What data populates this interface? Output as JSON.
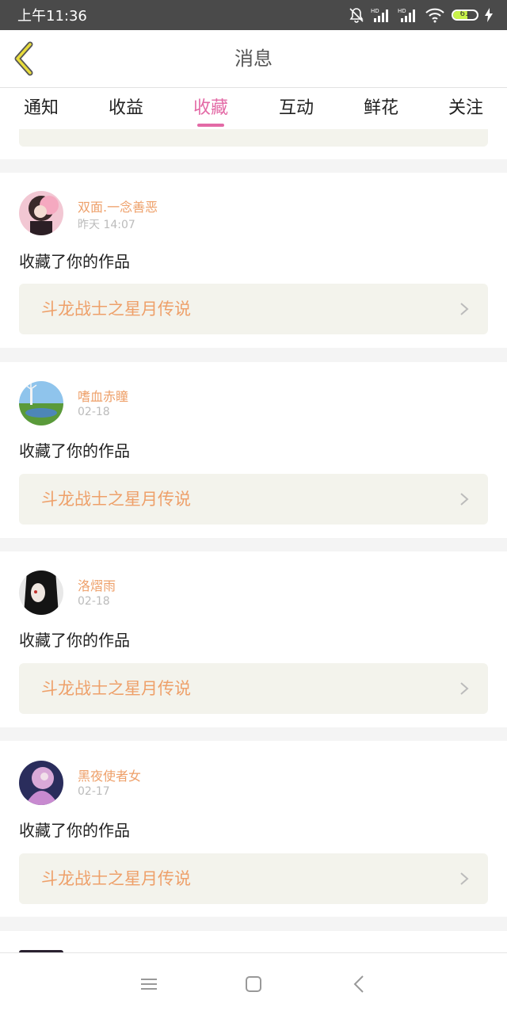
{
  "status_bar": {
    "time": "上午11:36",
    "icons": [
      "mute-bell-icon",
      "hd-signal-icon",
      "hd-signal-icon",
      "wifi-icon",
      "battery-icon",
      "charging-bolt-icon"
    ],
    "battery_level": "61",
    "battery_fill": 0.61
  },
  "header": {
    "title": "消息",
    "back_icon": "chevron-left-icon",
    "accent_color": "#e36aa6"
  },
  "tabs": [
    {
      "label": "通知"
    },
    {
      "label": "收益"
    },
    {
      "label": "收藏",
      "active": true
    },
    {
      "label": "互动"
    },
    {
      "label": "鲜花"
    },
    {
      "label": "关注"
    }
  ],
  "feed": [
    {
      "username": "双面.一念善恶",
      "time": "昨天 14:07",
      "action": "收藏了你的作品",
      "work_title": "斗龙战士之星月传说"
    },
    {
      "username": "嗜血赤瞳",
      "time": "02-18",
      "action": "收藏了你的作品",
      "work_title": "斗龙战士之星月传说"
    },
    {
      "username": "洛熠雨",
      "time": "02-18",
      "action": "收藏了你的作品",
      "work_title": "斗龙战士之星月传说"
    },
    {
      "username": "黑夜使者女",
      "time": "02-17",
      "action": "收藏了你的作品",
      "work_title": "斗龙战士之星月传说"
    }
  ],
  "bottom_nav": {
    "items": [
      "menu-icon",
      "home-square-icon",
      "back-icon"
    ]
  }
}
